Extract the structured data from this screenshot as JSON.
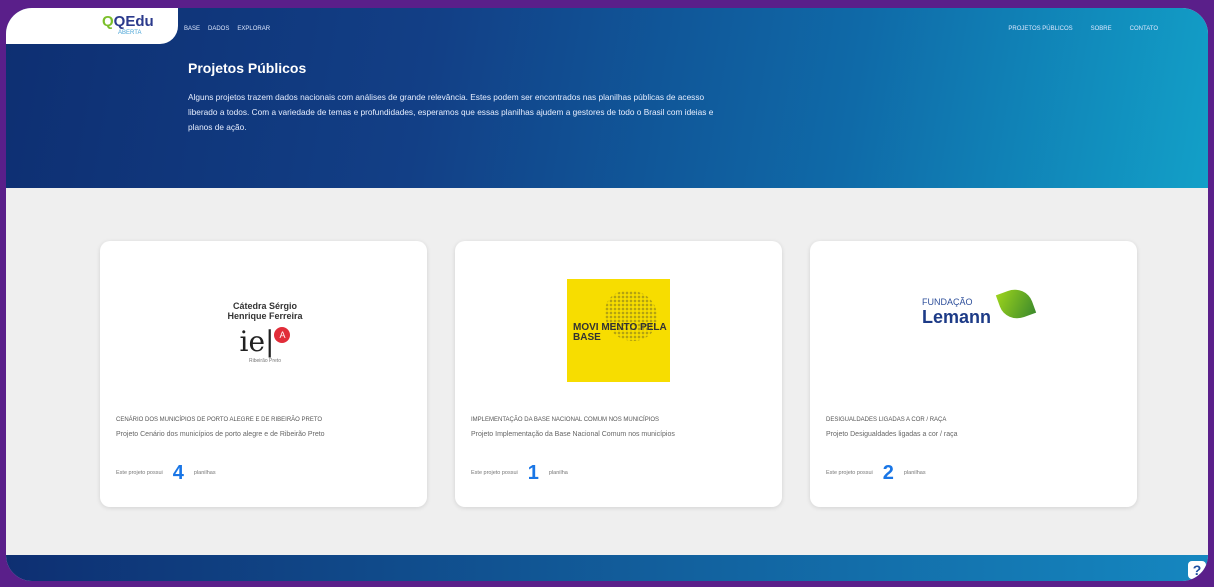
{
  "header": {
    "logo_text": "QEdu",
    "logo_sub": "ABERTA",
    "nav_left": [
      "BASE",
      "DADOS",
      "EXPLORAR"
    ],
    "nav_right": [
      "PROJETOS PÚBLICOS",
      "SOBRE",
      "CONTATO"
    ]
  },
  "hero": {
    "title": "Projetos Públicos",
    "text": "Alguns projetos trazem dados nacionais com análises de grande relevância. Estes podem ser encontrados nas planilhas públicas de acesso liberado a todos. Com a variedade de temas e profundidades, esperamos que essas planilhas ajudem a gestores de todo o Brasil com ideias e planos de ação."
  },
  "cards": [
    {
      "logo_title": "Cátedra Sérgio Henrique Ferreira",
      "logo_ie": "ie|",
      "logo_badge": "A",
      "logo_foot": "Ribeirão Preto",
      "title": "CENÁRIO DOS MUNICÍPIOS DE PORTO ALEGRE E DE RIBEIRÃO PRETO",
      "subtitle": "Projeto Cenário dos municípios de porto alegre e de Ribeirão Preto",
      "count_prefix": "Este projeto possui",
      "count": "4",
      "count_suffix": "planilhas"
    },
    {
      "logo_text": "MOVI MENTO PELA BASE",
      "title": "IMPLEMENTAÇÃO DA BASE NACIONAL COMUM NOS MUNICÍPIOS",
      "subtitle": "Projeto Implementação da Base Nacional Comum nos municípios",
      "count_prefix": "Este projeto possui",
      "count": "1",
      "count_suffix": "planilha"
    },
    {
      "logo_top": "FUNDAÇÃO",
      "logo_main": "Lemann",
      "title": "DESIGUALDADES LIGADAS A COR / RAÇA",
      "subtitle": "Projeto Desigualdades ligadas a cor / raça",
      "count_prefix": "Este projeto possui",
      "count": "2",
      "count_suffix": "planilhas"
    }
  ],
  "icons": [
    "search-icon",
    "user-icon",
    "help-icon"
  ]
}
